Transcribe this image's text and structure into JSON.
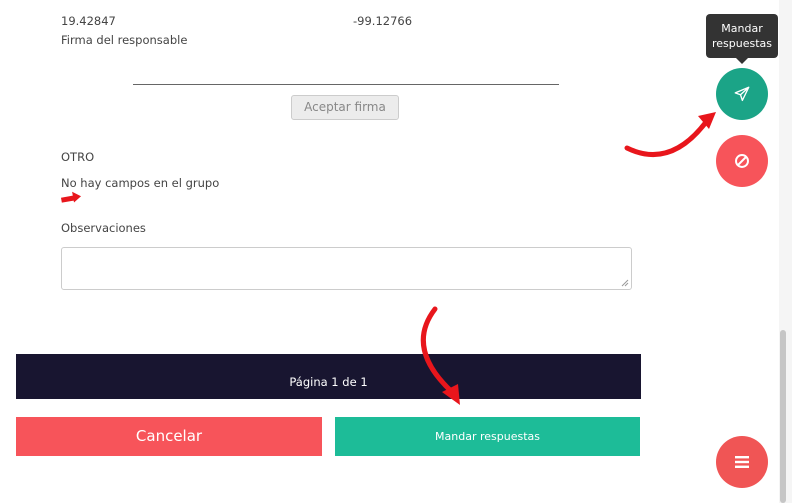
{
  "form": {
    "latitude": "19.42847",
    "longitude": "-99.12766",
    "signature_label": "Firma del responsable",
    "accept_signature_label": "Aceptar firma",
    "group_title": "OTRO",
    "empty_group_text": "No hay campos en el grupo",
    "observations_label": "Observaciones",
    "observations_value": ""
  },
  "pager": {
    "text": "Página 1 de 1"
  },
  "actions": {
    "cancel_label": "Cancelar",
    "send_label": "Mandar respuestas"
  },
  "floating": {
    "tooltip_line1": "Mandar",
    "tooltip_line2": "respuestas",
    "send_icon": "paper-plane-icon",
    "cancel_icon": "ban-icon",
    "menu_icon": "menu-icon"
  },
  "colors": {
    "teal": "#1dbc98",
    "red": "#f7545a",
    "dark_navy": "#181530",
    "annotation_arrow": "#e8161c"
  }
}
